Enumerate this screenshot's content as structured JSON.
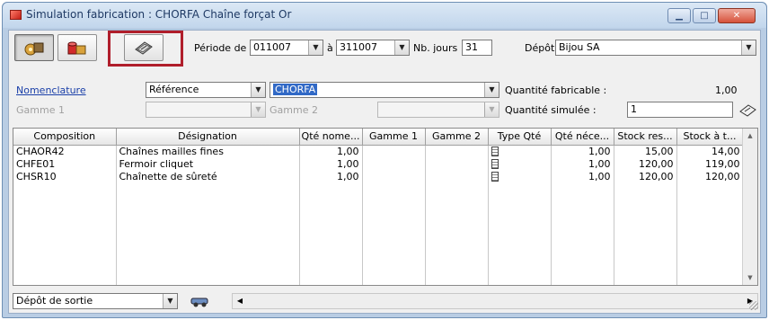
{
  "window": {
    "title": "Simulation fabrication : CHORFA Chaîne forçat Or",
    "minimize_glyph": "▁",
    "maximize_glyph": "□",
    "close_glyph": "✕"
  },
  "toolbar": {
    "buttons": [
      {
        "icon": "components-icon"
      },
      {
        "icon": "stock-boxes-icon"
      },
      {
        "icon": "calculate-icon"
      }
    ]
  },
  "filters": {
    "periode_label": "Période de",
    "periode_from": "011007",
    "periode_to_label": "à",
    "periode_to": "311007",
    "nb_jours_label": "Nb. jours",
    "nb_jours": "31",
    "depot_label": "Dépôt",
    "depot_value": "Bijou SA"
  },
  "form": {
    "nomenclature_link": "Nomenclature",
    "reference_type": "Référence",
    "reference_value": "CHORFA",
    "quantite_fabricable_label": "Quantité fabricable :",
    "quantite_fabricable_value": "1,00",
    "gamme1_label": "Gamme 1",
    "gamme2_label": "Gamme 2",
    "quantite_simulee_label": "Quantité simulée :",
    "quantite_simulee_value": "1"
  },
  "grid": {
    "columns": [
      "Composition",
      "Désignation",
      "Qté nome...",
      "Gamme 1",
      "Gamme 2",
      "Type Qté",
      "Qté néce...",
      "Stock res...",
      "Stock à t..."
    ],
    "rows": [
      {
        "composition": "CHAOR42",
        "designation": "Chaînes mailles fines",
        "qte_nomenclature": "1,00",
        "gamme1": "",
        "gamme2": "",
        "qte_necessaire": "1,00",
        "stock_reserve": "15,00",
        "stock_a_terme": "14,00"
      },
      {
        "composition": "CHFE01",
        "designation": "Fermoir cliquet",
        "qte_nomenclature": "1,00",
        "gamme1": "",
        "gamme2": "",
        "qte_necessaire": "1,00",
        "stock_reserve": "120,00",
        "stock_a_terme": "119,00"
      },
      {
        "composition": "CHSR10",
        "designation": "Chaînette de sûreté",
        "qte_nomenclature": "1,00",
        "gamme1": "",
        "gamme2": "",
        "qte_necessaire": "1,00",
        "stock_reserve": "120,00",
        "stock_a_terme": "120,00"
      }
    ]
  },
  "statusbar": {
    "depot_sortie": "Dépôt de sortie"
  }
}
